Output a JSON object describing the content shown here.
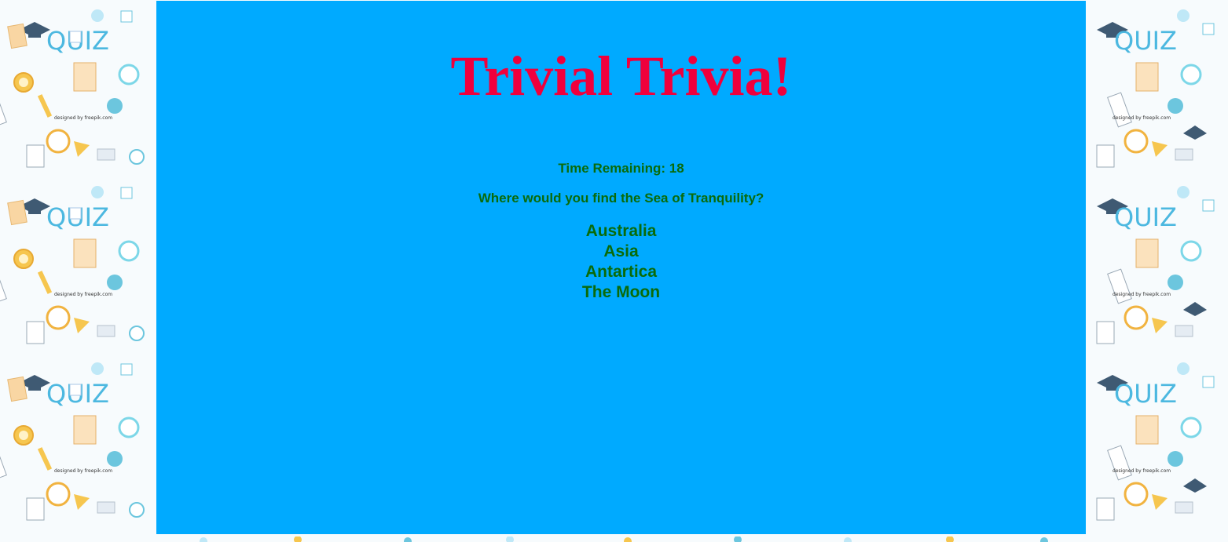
{
  "page": {
    "title": "Trivial Trivia!",
    "timer_label": "Time Remaining: ",
    "time_remaining": "18",
    "question": "Where would you find the Sea of Tranquility?",
    "answers": [
      "Australia",
      "Asia",
      "Antartica",
      "The Moon"
    ]
  },
  "background": {
    "tile_word": "QUIZ",
    "tile_credit": "designed by freepik.com"
  },
  "colors": {
    "main_bg": "#00aaff",
    "title": "#f0003c",
    "text": "#0a6b0a",
    "quiz_word": "#4cb8e0"
  }
}
